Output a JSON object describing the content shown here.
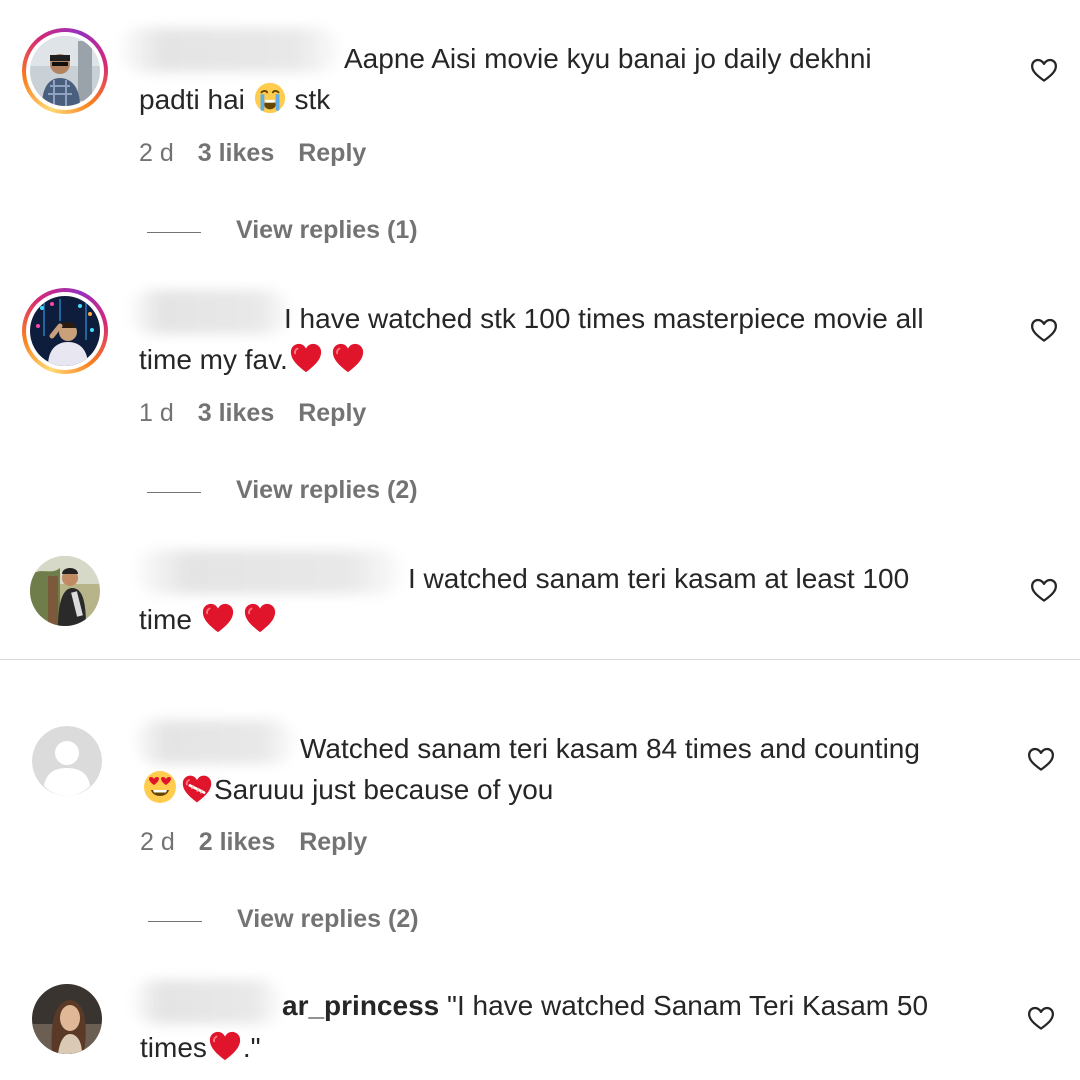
{
  "comments": [
    {
      "username": "",
      "text_line1": "Aapne Aisi movie kyu banai jo daily dekhni",
      "text_line2_pre": "padti hai",
      "text_line2_post": "stk",
      "time": "2 d",
      "likes": "3 likes",
      "reply": "Reply",
      "view_replies": "View replies (1)"
    },
    {
      "username": "",
      "text_line1": "I have watched stk 100 times masterpiece movie all",
      "text_line2_pre": "time my fav.",
      "time": "1 d",
      "likes": "3 likes",
      "reply": "Reply",
      "view_replies": "View replies (2)"
    },
    {
      "username": "",
      "text_line1": "I watched sanam teri kasam at least 100",
      "text_line2_pre": "time"
    },
    {
      "username": "",
      "text_line1": "Watched sanam teri kasam 84 times and counting",
      "text_line2_post": "Saruuu just because of you",
      "time": "2 d",
      "likes": "2 likes",
      "reply": "Reply",
      "view_replies": "View replies (2)"
    },
    {
      "username": "ar_princess",
      "text_line1": "\"I have watched Sanam Teri Kasam 50",
      "text_line2_pre": "times",
      "text_line2_post": ".\""
    }
  ],
  "icons": {
    "like": "heart-outline-icon",
    "emoji_crying": "loudly-crying-face",
    "emoji_heart": "red-heart",
    "emoji_heart_eyes": "smiling-face-with-heart-eyes",
    "emoji_mending_heart": "mending-heart"
  },
  "colors": {
    "text": "#262626",
    "secondary": "#737373",
    "divider": "#dbdbdb",
    "heart_red": "#e0142b",
    "story_ring": "#d62976"
  }
}
